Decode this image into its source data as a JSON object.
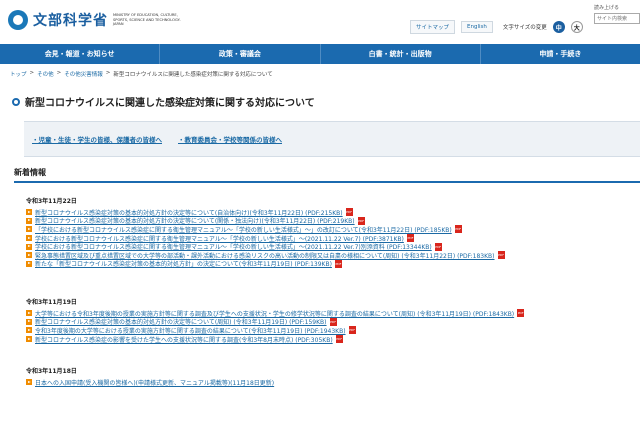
{
  "header": {
    "logo_name": "文部科学省",
    "logo_en": "MINISTRY OF EDUCATION, CULTURE, SPORTS, SCIENCE AND TECHNOLOGY-JAPAN",
    "sitemap_label": "サイトマップ",
    "english_label": "English",
    "font_size_label": "文字サイズの変更",
    "font_mid": "中",
    "font_big": "大",
    "search_small": "読み上げる",
    "search_placeholder": "サイト内検索"
  },
  "nav": {
    "items": [
      {
        "label": "会見・報道・お知らせ"
      },
      {
        "label": "政策・審議会"
      },
      {
        "label": "白書・統計・出版物"
      },
      {
        "label": "申請・手続き"
      }
    ]
  },
  "breadcrumb": {
    "items": [
      "トップ",
      "その他",
      "その他災害情報",
      "新型コロナウイルスに関連した感染症対策に関する対応について"
    ]
  },
  "page": {
    "title": "新型コロナウイルスに関連した感染症対策に関する対応について"
  },
  "quick_links": [
    {
      "label": "児童・生徒・学生の皆様、保護者の皆様へ"
    },
    {
      "label": "教育委員会・学校等関係の皆様へ"
    }
  ],
  "news": {
    "heading": "新着情報",
    "pdf_label": "PDF",
    "sections": [
      {
        "date": "令和3年11月22日",
        "items": [
          {
            "text": "新型コロナウイルス感染症対策の基本的対処方針の決定等について(自治体向け)(令和3年11月22日) (PDF:215KB)",
            "pdf": true
          },
          {
            "text": "新型コロナウイルス感染症対策の基本的対処方針の決定等について(関係・独法向け)(令和3年11月22日) (PDF:219KB)",
            "pdf": true
          },
          {
            "text": "「学校における新型コロナウイルス感染症に関する衛生管理マニュアル～「学校の新しい生活様式」～」の改訂について(令和3年11月22日) (PDF:185KB)",
            "pdf": true
          },
          {
            "text": "学校における新型コロナウイルス感染症に関する衛生管理マニュアル～「学校の新しい生活様式」～(2021.11.22 Ver.7) (PDF:3871KB)",
            "pdf": true
          },
          {
            "text": "学校における新型コロナウイルス感染症に関する衛生管理マニュアル～「学校の新しい生活様式」～(2021.11.22 Ver.7)別添資料 (PDF:13344KB)",
            "pdf": true
          },
          {
            "text": "緊急事態措置区域及び重点措置区域での大学等の部活動・課外活動における感染リスクの高い活動の制限又は自粛の様相について(周知) (令和3年11月22日) (PDF:183KB)",
            "pdf": true
          },
          {
            "text": "新たな「新型コロナウイルス感染症対策の基本的対処方針」の決定について(令和3年11月19日) (PDF:139KB)",
            "pdf": true
          }
        ]
      },
      {
        "date": "令和3年11月19日",
        "items": [
          {
            "text": "大学等における令和3年度後期の授業の実施方針等に関する調査及び学生への支援状況・学生の修学状況等に関する調査の結果について(周知) (令和3年11月19日) (PDF:1843KB)",
            "pdf": true
          },
          {
            "text": "新型コロナウイルス感染症対策の基本的対処方針の決定等について(周知) (令和3年11月19日) (PDF:159KB)",
            "pdf": true
          },
          {
            "text": "令和3年度後期の大学等における授業の実施方針等に関する調査の結果について(令和3年11月19日) (PDF:1943KB)",
            "pdf": true
          },
          {
            "text": "新型コロナウイルス感染症の影響を受けた学生への支援状況等に関する調査(令和3年8月末時点) (PDF:305KB)",
            "pdf": true
          }
        ]
      },
      {
        "date": "令和3年11月18日",
        "items": [
          {
            "text": "日本への入国申請(受入機関の皆様へ)(申請様式更新、マニュアル掲載等)(11月18日更新)",
            "pdf": false
          }
        ]
      }
    ]
  },
  "colors": {
    "brand": "#1b6aaf",
    "link": "#1b6aa5",
    "bullet": "#f08c00",
    "pdf": "#d9261c"
  }
}
